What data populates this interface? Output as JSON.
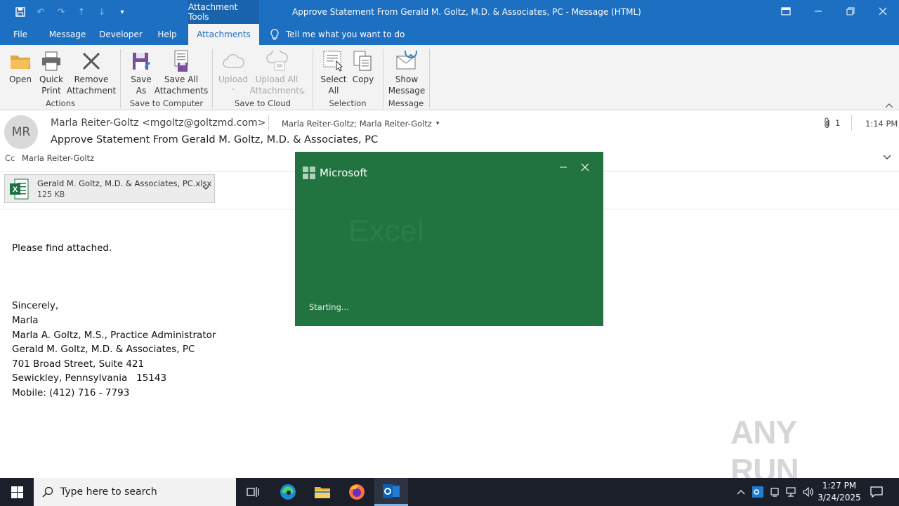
{
  "titlebar": {
    "context_tab": "Attachment Tools",
    "title": "Approve Statement From Gerald M. Goltz, M.D. & Associates, PC  -  Message (HTML)"
  },
  "tabs": [
    {
      "label": "File"
    },
    {
      "label": "Message"
    },
    {
      "label": "Developer"
    },
    {
      "label": "Help"
    },
    {
      "label": "Attachments",
      "active": true
    }
  ],
  "tell_me": "Tell me what you want to do",
  "ribbon": {
    "actions": {
      "label": "Actions",
      "open": "Open",
      "quick_print_1": "Quick",
      "quick_print_2": "Print",
      "remove_1": "Remove",
      "remove_2": "Attachment"
    },
    "save_to_computer": {
      "label": "Save to Computer",
      "save_as_1": "Save",
      "save_as_2": "As",
      "save_all_1": "Save All",
      "save_all_2": "Attachments"
    },
    "save_to_cloud": {
      "label": "Save to Cloud",
      "upload": "Upload",
      "upload_all_1": "Upload All",
      "upload_all_2": "Attachments"
    },
    "selection": {
      "label": "Selection",
      "select_all_1": "Select",
      "select_all_2": "All",
      "copy": "Copy"
    },
    "message": {
      "label": "Message",
      "show_1": "Show",
      "show_2": "Message"
    }
  },
  "message": {
    "avatar_initials": "MR",
    "sender": "Marla Reiter-Goltz <mgoltz@goltzmd.com>",
    "recipients": "Marla Reiter-Goltz; Marla Reiter-Goltz",
    "subject": "Approve Statement From Gerald M. Goltz, M.D. & Associates, PC",
    "attachment_count": "1",
    "time": "1:14 PM",
    "cc_label": "Cc",
    "cc": "Marla Reiter-Goltz"
  },
  "attachment": {
    "filename": "Gerald M. Goltz, M.D. & Associates, PC.xlsx",
    "size": "125 KB"
  },
  "body_lines": [
    "Please find attached.",
    "",
    "",
    "",
    "Sincerely,",
    "Marla",
    "Marla A. Goltz, M.S., Practice Administrator",
    "Gerald M. Goltz, M.D. & Associates, PC",
    "701 Broad Street, Suite 421",
    "Sewickley, Pennsylvania   15143",
    "Mobile: (412) 716 - 7793"
  ],
  "splash": {
    "brand": "Microsoft",
    "product": "Excel",
    "status": "Starting..."
  },
  "watermark": "ANY RUN",
  "taskbar": {
    "search_placeholder": "Type here to search",
    "time": "1:27 PM",
    "date": "3/24/2025"
  },
  "colors": {
    "accent": "#1c6fc1",
    "excel_green": "#21743f",
    "taskbar": "#1b1f2a"
  }
}
